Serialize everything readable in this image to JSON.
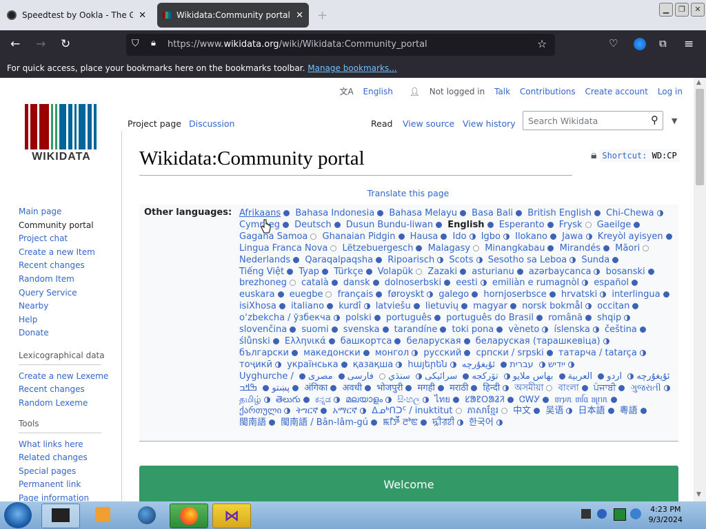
{
  "browser": {
    "tabs": [
      {
        "title": "Speedtest by Ookla - The Global",
        "active": false
      },
      {
        "title": "Wikidata:Community portal - W",
        "active": true
      }
    ],
    "url_prefix": "https://www.",
    "url_domain": "wikidata.org",
    "url_path": "/wiki/Wikidata:Community_portal",
    "bookmarks_text": "For quick access, place your bookmarks here on the bookmarks toolbar.",
    "bookmarks_link": "Manage bookmarks..."
  },
  "user_links": {
    "language": "English",
    "not_logged_in": "Not logged in",
    "talk": "Talk",
    "contributions": "Contributions",
    "create_account": "Create account",
    "login": "Log in"
  },
  "logo_text": "WIKIDATA",
  "sidebar": {
    "nav": [
      "Main page",
      "Community portal",
      "Project chat",
      "Create a new Item",
      "Recent changes",
      "Random Item",
      "Query Service",
      "Nearby",
      "Help",
      "Donate"
    ],
    "lexico_heading": "Lexicographical data",
    "lexico": [
      "Create a new Lexeme",
      "Recent changes",
      "Random Lexeme"
    ],
    "tools_heading": "Tools",
    "tools": [
      "What links here",
      "Related changes",
      "Special pages",
      "Permanent link",
      "Page information"
    ]
  },
  "page_tabs": {
    "project_page": "Project page",
    "discussion": "Discussion",
    "read": "Read",
    "view_source": "View source",
    "view_history": "View history"
  },
  "search_placeholder": "Search Wikidata",
  "page_title": "Wikidata:Community portal",
  "shortcut": "Shortcut:",
  "shortcut_code": "WD:CP",
  "translate_link": "Translate this page",
  "other_languages_label": "Other languages:",
  "languages": [
    {
      "n": "Afrikaans",
      "s": "full"
    },
    {
      "n": "Bahasa Indonesia",
      "s": "full"
    },
    {
      "n": "Bahasa Melayu",
      "s": "full"
    },
    {
      "n": "Basa Bali",
      "s": "full"
    },
    {
      "n": "British English",
      "s": "full"
    },
    {
      "n": "Chi-Chewa",
      "s": "half"
    },
    {
      "n": "Cymraeg",
      "s": "full"
    },
    {
      "n": "Deutsch",
      "s": "full"
    },
    {
      "n": "Dusun Bundu-liwan",
      "s": "full"
    },
    {
      "n": "English",
      "s": "full"
    },
    {
      "n": "Esperanto",
      "s": "full"
    },
    {
      "n": "Frysk",
      "s": "empty"
    },
    {
      "n": "Gaeilge",
      "s": "full"
    },
    {
      "n": "Gagana Samoa",
      "s": "empty"
    },
    {
      "n": "Ghanaian Pidgin",
      "s": "full"
    },
    {
      "n": "Hausa",
      "s": "full"
    },
    {
      "n": "Ido",
      "s": "half"
    },
    {
      "n": "Igbo",
      "s": "half"
    },
    {
      "n": "Ilokano",
      "s": "full"
    },
    {
      "n": "Jawa",
      "s": "half"
    },
    {
      "n": "Kreyòl ayisyen",
      "s": "full"
    },
    {
      "n": "Lingua Franca Nova",
      "s": "empty"
    },
    {
      "n": "Lëtzebuergesch",
      "s": "full"
    },
    {
      "n": "Malagasy",
      "s": "empty"
    },
    {
      "n": "Minangkabau",
      "s": "full"
    },
    {
      "n": "Mirandés",
      "s": "full"
    },
    {
      "n": "Māori",
      "s": "empty"
    },
    {
      "n": "Nederlands",
      "s": "full"
    },
    {
      "n": "Qaraqalpaqsha",
      "s": "full"
    },
    {
      "n": "Ripoarisch",
      "s": "half"
    },
    {
      "n": "Scots",
      "s": "half"
    },
    {
      "n": "Sesotho sa Leboa",
      "s": "half"
    },
    {
      "n": "Sunda",
      "s": "full"
    },
    {
      "n": "Tiếng Việt",
      "s": "full"
    },
    {
      "n": "Tyap",
      "s": "full"
    },
    {
      "n": "Türkçe",
      "s": "full"
    },
    {
      "n": "Volapük",
      "s": "empty"
    },
    {
      "n": "Zazaki",
      "s": "full"
    },
    {
      "n": "asturianu",
      "s": "full"
    },
    {
      "n": "azərbaycanca",
      "s": "half"
    },
    {
      "n": "bosanski",
      "s": "full"
    },
    {
      "n": "brezhoneg",
      "s": "empty"
    },
    {
      "n": "català",
      "s": "full"
    },
    {
      "n": "dansk",
      "s": "full"
    },
    {
      "n": "dolnoserbski",
      "s": "full"
    },
    {
      "n": "eesti",
      "s": "half"
    },
    {
      "n": "emiliàn e rumagnòl",
      "s": "half"
    },
    {
      "n": "español",
      "s": "full"
    },
    {
      "n": "euskara",
      "s": "full"
    },
    {
      "n": "euegbe",
      "s": "empty"
    },
    {
      "n": "français",
      "s": "full"
    },
    {
      "n": "føroyskt",
      "s": "half"
    },
    {
      "n": "galego",
      "s": "full"
    },
    {
      "n": "hornjoserbsce",
      "s": "full"
    },
    {
      "n": "hrvatski",
      "s": "half"
    },
    {
      "n": "interlingua",
      "s": "full"
    },
    {
      "n": "isiXhosa",
      "s": "full"
    },
    {
      "n": "italiano",
      "s": "full"
    },
    {
      "n": "kurdî",
      "s": "half"
    },
    {
      "n": "latviešu",
      "s": "full"
    },
    {
      "n": "lietuvių",
      "s": "full"
    },
    {
      "n": "magyar",
      "s": "full"
    },
    {
      "n": "norsk bokmål",
      "s": "half"
    },
    {
      "n": "occitan",
      "s": "full"
    },
    {
      "n": "oʻzbekcha / ўзбекча",
      "s": "half"
    },
    {
      "n": "polski",
      "s": "full"
    },
    {
      "n": "português",
      "s": "full"
    },
    {
      "n": "português do Brasil",
      "s": "full"
    },
    {
      "n": "română",
      "s": "full"
    },
    {
      "n": "shqip",
      "s": "half"
    },
    {
      "n": "slovenčina",
      "s": "full"
    },
    {
      "n": "suomi",
      "s": "full"
    },
    {
      "n": "svenska",
      "s": "full"
    },
    {
      "n": "tarandíne",
      "s": "full"
    },
    {
      "n": "toki pona",
      "s": "full"
    },
    {
      "n": "vèneto",
      "s": "half"
    },
    {
      "n": "íslenska",
      "s": "half"
    },
    {
      "n": "čeština",
      "s": "full"
    },
    {
      "n": "ślůnski",
      "s": "full"
    },
    {
      "n": "Ελληνικά",
      "s": "full"
    },
    {
      "n": "башкортса",
      "s": "full"
    },
    {
      "n": "беларуская",
      "s": "full"
    },
    {
      "n": "беларуская (тарашкевіца)",
      "s": "half"
    },
    {
      "n": "български",
      "s": "full"
    },
    {
      "n": "македонски",
      "s": "full"
    },
    {
      "n": "монгол",
      "s": "half"
    },
    {
      "n": "русский",
      "s": "full"
    },
    {
      "n": "српски / srpski",
      "s": "full"
    },
    {
      "n": "татарча / tatarça",
      "s": "half"
    },
    {
      "n": "тоҷикӣ",
      "s": "half"
    },
    {
      "n": "українська",
      "s": "full"
    },
    {
      "n": "қазақша",
      "s": "half"
    },
    {
      "n": "հայերեն",
      "s": "half"
    },
    {
      "n": "ייִדיש",
      "s": "half"
    },
    {
      "n": "עברית",
      "s": "full"
    },
    {
      "n": "ئۇيغۇرچە",
      "s": "half"
    },
    {
      "n": "Uyghurche / ئۇيغۇرچە",
      "s": "half"
    },
    {
      "n": "اردو",
      "s": "full"
    },
    {
      "n": "العربية",
      "s": "full"
    },
    {
      "n": "بهاس ملايو",
      "s": "half"
    },
    {
      "n": "تۆرکجه",
      "s": "full"
    },
    {
      "n": "سرائیکی",
      "s": "half"
    },
    {
      "n": "سنڌي",
      "s": "empty"
    },
    {
      "n": "فارسی",
      "s": "full"
    },
    {
      "n": "مصرى",
      "s": "full"
    },
    {
      "n": "پښتو",
      "s": "full"
    },
    {
      "n": "ߒߞߏ",
      "s": "full"
    },
    {
      "n": "अंगिका",
      "s": "full"
    },
    {
      "n": "अवधी",
      "s": "full"
    },
    {
      "n": "भोजपुरी",
      "s": "full"
    },
    {
      "n": "मगही",
      "s": "full"
    },
    {
      "n": "मराठी",
      "s": "full"
    },
    {
      "n": "हिन्दी",
      "s": "half"
    },
    {
      "n": "অসমীয়া",
      "s": "empty"
    },
    {
      "n": "বাংলা",
      "s": "full"
    },
    {
      "n": "ਪੰਜਾਬੀ",
      "s": "full"
    },
    {
      "n": "ગુજરાતી",
      "s": "half"
    },
    {
      "n": "தமிழ்",
      "s": "half"
    },
    {
      "n": "తెలుగు",
      "s": "full"
    },
    {
      "n": "ಕನ್ನಡ",
      "s": "half"
    },
    {
      "n": "മലയാളം",
      "s": "half"
    },
    {
      "n": "සිංහල",
      "s": "half"
    },
    {
      "n": "ไทย",
      "s": "full"
    },
    {
      "n": "ᱥᱟᱱᱛᱟᱲᱤ",
      "s": "full"
    },
    {
      "n": "ᏣᎳᎩ",
      "s": "full"
    },
    {
      "n": "ᥖᥭᥰ ᥖᥬᥲ ᥑᥨᥒᥰ",
      "s": "full"
    },
    {
      "n": "ქართული",
      "s": "half"
    },
    {
      "n": "ትግርኛ",
      "s": "full"
    },
    {
      "n": "አማርኛ",
      "s": "half"
    },
    {
      "n": "ᐃᓄᒃᑎᑐᑦ / inuktitut",
      "s": "empty"
    },
    {
      "n": "ភាសាខ្មែរ",
      "s": "empty"
    },
    {
      "n": "中文",
      "s": "full"
    },
    {
      "n": "吴语",
      "s": "half"
    },
    {
      "n": "日本語",
      "s": "full"
    },
    {
      "n": "粵語",
      "s": "full"
    },
    {
      "n": "閩南語",
      "s": "full"
    },
    {
      "n": "閩南語 / Bân-lâm-gú",
      "s": "full"
    },
    {
      "n": "ꯃꯤꯇꯩ ꯂꯣꯟ",
      "s": "full"
    },
    {
      "n": "ꠍꠤꠟꠐꠤ",
      "s": "half"
    },
    {
      "n": "한국어",
      "s": "half"
    }
  ],
  "welcome": "Welcome",
  "taskbar": {
    "time": "4:23 PM",
    "date": "9/3/2024"
  },
  "colors": {
    "link": "#3366cc",
    "welcome_bg": "#339966",
    "browser_dark": "#2b2a33"
  }
}
